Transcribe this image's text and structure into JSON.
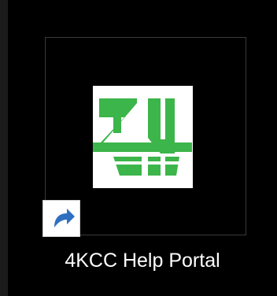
{
  "desktop": {
    "shortcut": {
      "label": "4KCC Help Portal",
      "icon": "4kcc-logo-icon",
      "overlay_icon": "shortcut-arrow-icon",
      "logo_green": "#3cb54a",
      "overlay_blue": "#2f6fc0"
    }
  }
}
